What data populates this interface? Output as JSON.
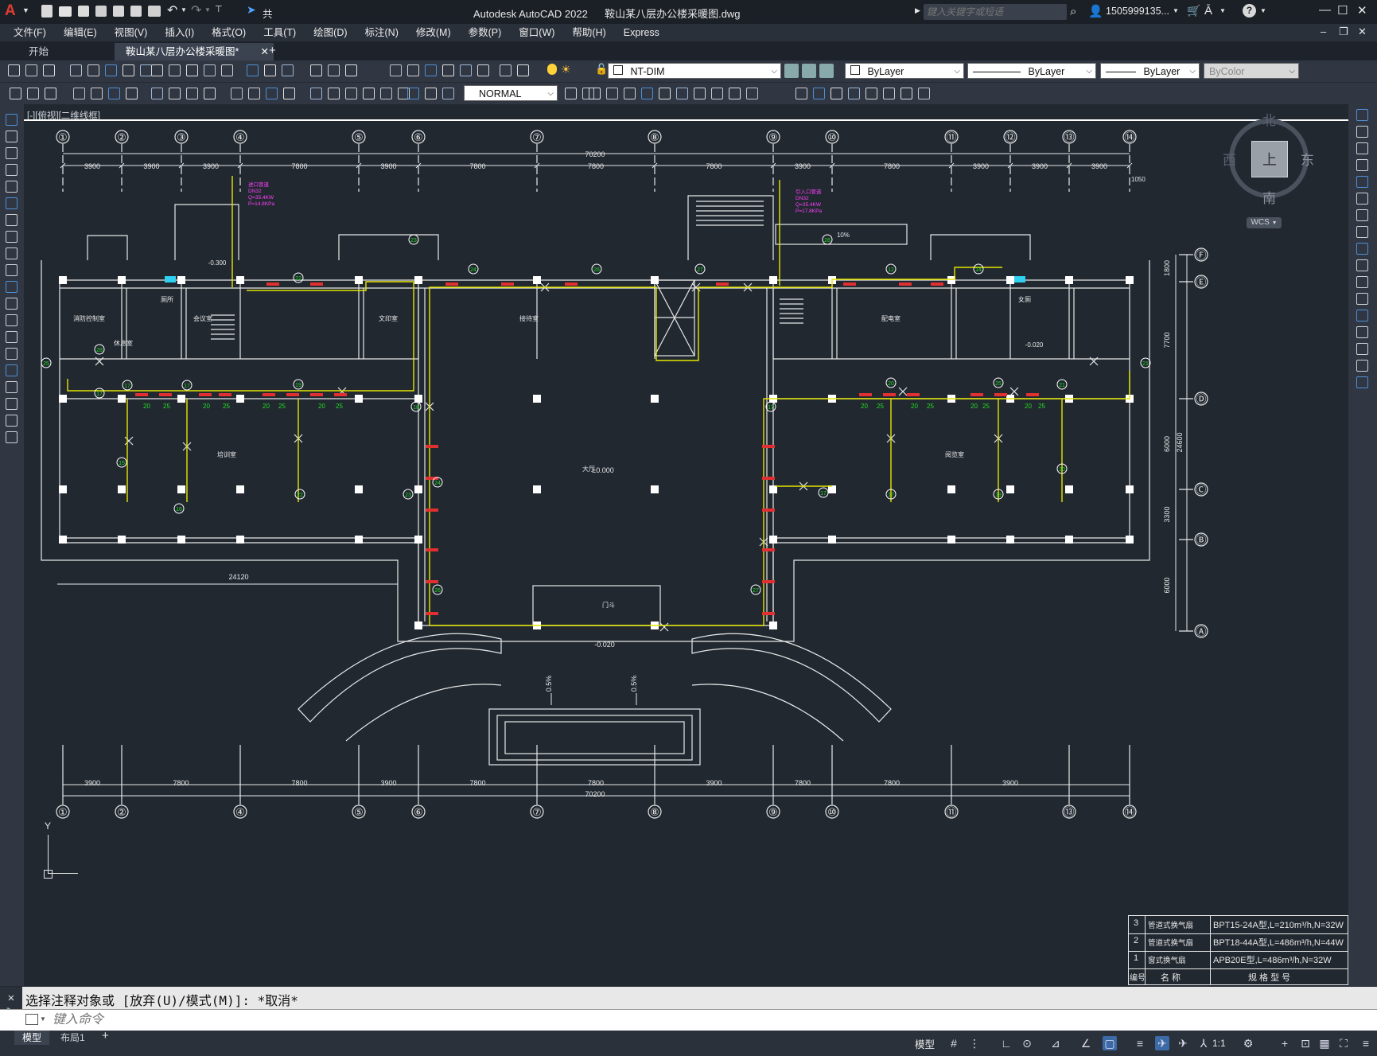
{
  "app": {
    "title": "Autodesk AutoCAD 2022",
    "file_name": "鞍山某八层办公楼采暖图.dwg",
    "share_label": "共享",
    "search_placeholder": "键入关键字或短语",
    "user": "1505999135...",
    "menus": [
      "文件(F)",
      "编辑(E)",
      "视图(V)",
      "插入(I)",
      "格式(O)",
      "工具(T)",
      "绘图(D)",
      "标注(N)",
      "修改(M)",
      "参数(P)",
      "窗口(W)",
      "帮助(H)",
      "Express"
    ],
    "tabs": [
      {
        "label": "开始"
      },
      {
        "label": "鞍山某八层办公楼采暖图*"
      }
    ],
    "viewport_label": "[-][俯视][二维线框]"
  },
  "toolbar": {
    "layer": "NT-DIM",
    "color": "ByLayer",
    "linetype": "ByLayer",
    "lineweight": "ByLayer",
    "plotstyle": "ByColor",
    "textstyle": "NORMAL"
  },
  "viewcube": {
    "north": "北",
    "south": "南",
    "east": "东",
    "west": "西",
    "face": "上",
    "wcs": "WCS"
  },
  "drawing": {
    "axis_top": [
      "①",
      "②",
      "③",
      "④",
      "⑤",
      "⑥",
      "⑦",
      "⑧",
      "⑨",
      "⑩",
      "⑪",
      "⑫",
      "⑬",
      "⑭"
    ],
    "axis_bottom": [
      "①",
      "②",
      "④",
      "⑤",
      "⑥",
      "⑦",
      "⑧",
      "⑨",
      "⑩",
      "⑪",
      "⑬",
      "⑭"
    ],
    "axis_right": [
      "Ⓕ",
      "Ⓔ",
      "Ⓓ",
      "Ⓒ",
      "Ⓑ",
      "Ⓐ"
    ],
    "dim_total": "70200",
    "dims_top": [
      "3900",
      "3900",
      "3900",
      "7800",
      "3900",
      "7800",
      "7800",
      "7800",
      "3900",
      "7800",
      "3900",
      "3900",
      "3900"
    ],
    "dims_bottom": [
      "3900",
      "7800",
      "7800",
      "3900",
      "7800",
      "7800",
      "3900",
      "7800",
      "7800",
      "3900"
    ],
    "dim_left_bottom": "24120",
    "dim_right_total": "24600",
    "dims_right": [
      "1800",
      "7700",
      "6000",
      "3300",
      "6000"
    ],
    "dim_1050": "1050",
    "rooms": [
      "消防控制室",
      "会议室",
      "文印室",
      "接待室",
      "休息室",
      "配电室",
      "大厅",
      "培训室",
      "阅览室",
      "门斗",
      "厕所",
      "女厕"
    ],
    "elev_hall": "±0.000",
    "elev_entry": "-0.020",
    "elev_a": "-0.300",
    "elev_b": "-0.020",
    "slope1": "0.5%",
    "slope2": "0.5%",
    "slope_ramp": "10%",
    "marks_in": [
      "进口管道",
      "DN32",
      "Q=35.4KW",
      "P=14.8KPa"
    ],
    "marks_in2": [
      "引入口管道",
      "DN32",
      "Q=35.4KW",
      "P=17.8KPa"
    ],
    "radiator_nums": [
      "17",
      "17",
      "17",
      "19",
      "20",
      "25",
      "21",
      "22",
      "23",
      "24",
      "26",
      "27",
      "28",
      "12",
      "14",
      "15",
      "16",
      "18"
    ]
  },
  "legend": {
    "rows": [
      {
        "no": "3",
        "name": "管道式换气扇",
        "spec": "BPT15-24A型,L=210m³/h,N=32W"
      },
      {
        "no": "2",
        "name": "管道式换气扇",
        "spec": "BPT18-44A型,L=486m³/h,N=44W"
      },
      {
        "no": "1",
        "name": "窗式换气扇",
        "spec": "APB20E型,L=486m³/h,N=32W"
      }
    ],
    "header": {
      "no": "编号",
      "name": "名 称",
      "spec": "规 格 型 号"
    }
  },
  "command": {
    "history": "选择注释对象或 [放弃(U)/模式(M)]: *取消*",
    "placeholder": "键入命令"
  },
  "status": {
    "model_tab": "模型",
    "layout_tab": "布局1",
    "model_btn": "模型",
    "scale": "1:1"
  }
}
